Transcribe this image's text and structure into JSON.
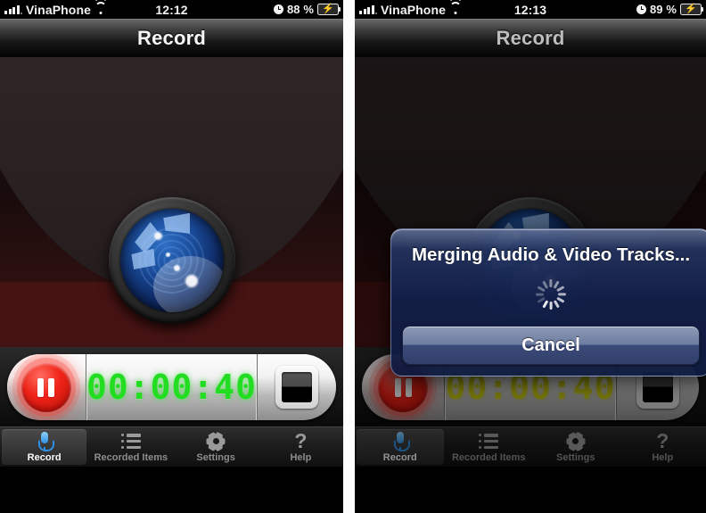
{
  "panels": [
    {
      "id": "left",
      "statusbar": {
        "carrier": "VinaPhone",
        "time": "12:12",
        "battery_pct": "88 %",
        "signal_icon": "signal-bars-icon",
        "wifi_icon": "wifi-icon",
        "alarm_icon": "alarm-clock-icon",
        "battery_icon": "battery-charging-icon"
      },
      "navbar": {
        "title": "Record"
      },
      "controls": {
        "record_button_label": "pause-record-button",
        "timer": "00:00:40",
        "timer_color": "#22dd22",
        "stop_button_label": "stop-button"
      },
      "tabs": [
        {
          "label": "Record",
          "icon": "microphone-icon",
          "active": true
        },
        {
          "label": "Recorded Items",
          "icon": "list-icon",
          "active": false
        },
        {
          "label": "Settings",
          "icon": "gear-icon",
          "active": false
        },
        {
          "label": "Help",
          "icon": "question-mark-icon",
          "active": false
        }
      ],
      "modal": null
    },
    {
      "id": "right",
      "statusbar": {
        "carrier": "VinaPhone",
        "time": "12:13",
        "battery_pct": "89 %",
        "signal_icon": "signal-bars-icon",
        "wifi_icon": "wifi-icon",
        "alarm_icon": "alarm-clock-icon",
        "battery_icon": "battery-charging-icon"
      },
      "navbar": {
        "title": "Record"
      },
      "controls": {
        "record_button_label": "pause-record-button",
        "timer": "00:00:40",
        "timer_color": "#c9c916",
        "stop_button_label": "stop-button"
      },
      "tabs": [
        {
          "label": "Record",
          "icon": "microphone-icon",
          "active": true
        },
        {
          "label": "Recorded Items",
          "icon": "list-icon",
          "active": false
        },
        {
          "label": "Settings",
          "icon": "gear-icon",
          "active": false
        },
        {
          "label": "Help",
          "icon": "question-mark-icon",
          "active": false
        }
      ],
      "modal": {
        "title": "Merging Audio & Video Tracks...",
        "spinner_icon": "activity-spinner-icon",
        "cancel_label": "Cancel"
      }
    }
  ],
  "theme": {
    "accent_blue": "#2f8fe0",
    "record_red": "#f02318",
    "lcd_green": "#22dd22",
    "lcd_yellow": "#c9c916",
    "dialog_blue": "#12204a"
  }
}
